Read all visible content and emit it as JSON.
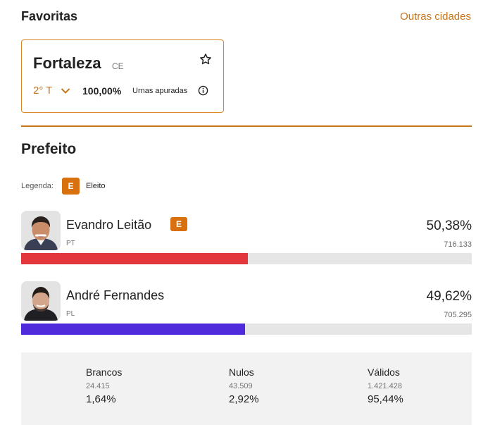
{
  "header": {
    "title": "Favoritas",
    "other_cities_link": "Outras cidades"
  },
  "city_card": {
    "name": "Fortaleza",
    "state": "CE",
    "round": "2° T",
    "urnas_percent": "100,00%",
    "urnas_label": "Urnas apuradas"
  },
  "section": {
    "title": "Prefeito",
    "legend_label": "Legenda:",
    "legend_badge": "E",
    "legend_text": "Eleito"
  },
  "candidates": [
    {
      "name": "Evandro Leitão",
      "party": "PT",
      "percent": "50,38%",
      "votes": "716.133",
      "share": 0.5038,
      "elected": true,
      "badge": "E",
      "color": "#e3353c"
    },
    {
      "name": "André Fernandes",
      "party": "PL",
      "percent": "49,62%",
      "votes": "705.295",
      "share": 0.4962,
      "elected": false,
      "badge": "",
      "color": "#4f2bdc"
    }
  ],
  "summary": {
    "brancos": {
      "label": "Brancos",
      "count": "24.415",
      "percent": "1,64%"
    },
    "nulos": {
      "label": "Nulos",
      "count": "43.509",
      "percent": "2,92%"
    },
    "validos": {
      "label": "Válidos",
      "count": "1.421.428",
      "percent": "95,44%"
    }
  },
  "colors": {
    "accent": "#c8741a",
    "badge": "#d9700f"
  },
  "icons": {
    "favorite": "star-outline-icon",
    "round_dropdown": "chevron-down-icon",
    "info": "info-circle-icon"
  }
}
